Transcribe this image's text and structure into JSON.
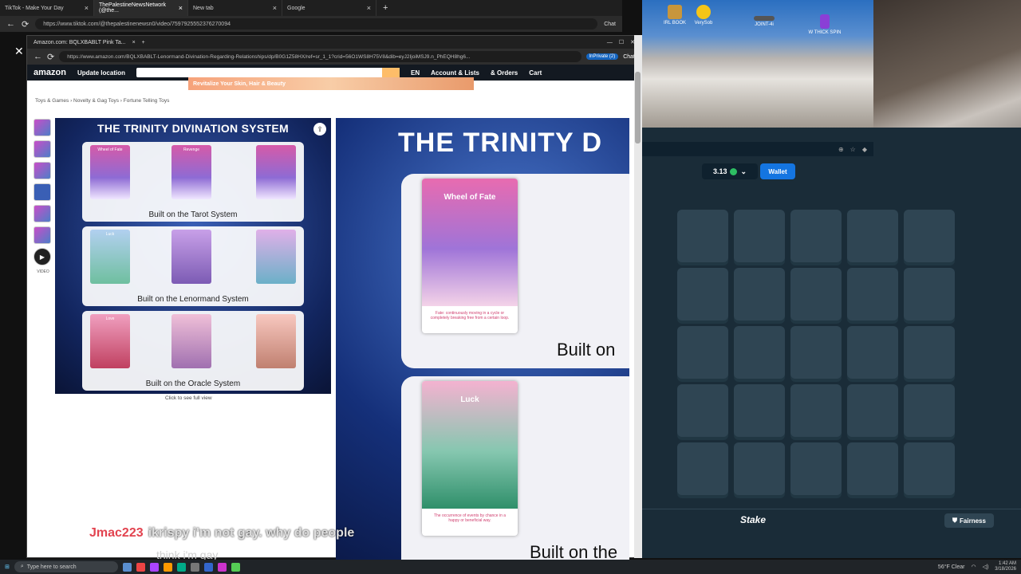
{
  "outer_browser": {
    "tabs": [
      {
        "label": "TikTok - Make Your Day"
      },
      {
        "label": "ThePalestineNewsNetwork (@the..."
      },
      {
        "label": "New tab"
      },
      {
        "label": "Google"
      }
    ],
    "url": "https://www.tiktok.com/@thepalestinenewsn0/video/7597925552376270094",
    "chat_label": "Chat"
  },
  "amazon_window": {
    "tab_title": "Amazon.com: BQLXBABLT Pink Ta...",
    "url": "https://www.amazon.com/BQLXBABLT-Lenormand-Divination-Regarding-Relationships/dp/B0G1Z58HX/ref=sr_1_1?crid=56O1WS8H75V8&dib=eyJ2IjoiMSJ9.n_PhEQH8hg6...",
    "private_label": "InPrivate (2)",
    "chat_label": "Chat",
    "header": {
      "logo": "amazon",
      "location": "Update location",
      "lang": "EN",
      "account": "Account & Lists",
      "orders": "& Orders",
      "cart": "Cart"
    },
    "banner": "Revitalize Your Skin, Hair & Beauty",
    "breadcrumb": "Toys & Games › Novelty & Gag Toys › Fortune Telling Toys",
    "main_image": {
      "title": "THE TRINITY DIVINATION SYSTEM",
      "systems": [
        {
          "label": "Built on the Tarot System",
          "cards": [
            "Wheel of Fate",
            "Revenge",
            ""
          ]
        },
        {
          "label": "Built on the Lenormand System",
          "cards": [
            "Luck",
            "",
            ""
          ]
        },
        {
          "label": "Built on the Oracle System",
          "cards": [
            "Love",
            "",
            ""
          ]
        }
      ]
    },
    "full_view": "Click to see full view",
    "video_label": "VIDEO",
    "zoom": {
      "title": "THE TRINITY D",
      "card1": {
        "name": "Wheel of Fate",
        "desc": "Fate: continuously moving in a cycle or completely breaking free from a certain loop."
      },
      "card2": {
        "name": "Luck",
        "desc": "The occurrence of events by chance in a happy or beneficial way."
      },
      "built1": "Built on",
      "built2": "Built on the"
    }
  },
  "desktop_icons": [
    {
      "label": "IRL BOOK"
    },
    {
      "label": "VerySob"
    },
    {
      "label": "JOINT-4i"
    },
    {
      "label": "W THICK SPIN"
    }
  ],
  "stake": {
    "balance": "3.13",
    "wallet_label": "Wallet",
    "tile_count": 25,
    "logo": "Stake",
    "fairness_label": "Fairness"
  },
  "chat_overlay": {
    "username": "Jmac223",
    "message_line1": "ikrispy i'm not gay. why do people",
    "message_line2": "think i'm gay"
  },
  "taskbar": {
    "search_placeholder": "Type here to search",
    "weather": "56°F Clear",
    "time": "1:42 AM",
    "date": "3/18/2026"
  },
  "colors": {
    "stake_bg": "#1a2c38",
    "stake_tile": "#2f4553",
    "wallet_blue": "#1475e1",
    "chat_name": "#e2434f"
  }
}
